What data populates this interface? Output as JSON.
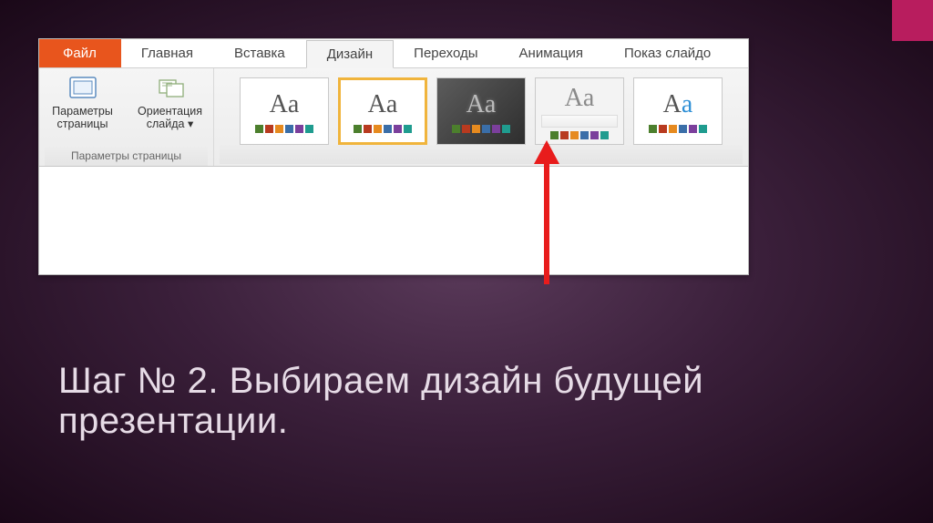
{
  "tabs": {
    "file": "Файл",
    "home": "Главная",
    "insert": "Вставка",
    "design": "Дизайн",
    "transitions": "Переходы",
    "animation": "Анимация",
    "slideshow": "Показ слайдо"
  },
  "pageSetupGroup": {
    "pageParams": "Параметры\nстраницы",
    "slideOrientation": "Ориентация\nслайда",
    "dropdownMark": "▾",
    "label": "Параметры страницы"
  },
  "themes": {
    "thumbText": "Aa"
  },
  "caption": "Шаг № 2. Выбираем дизайн будущей презентации."
}
